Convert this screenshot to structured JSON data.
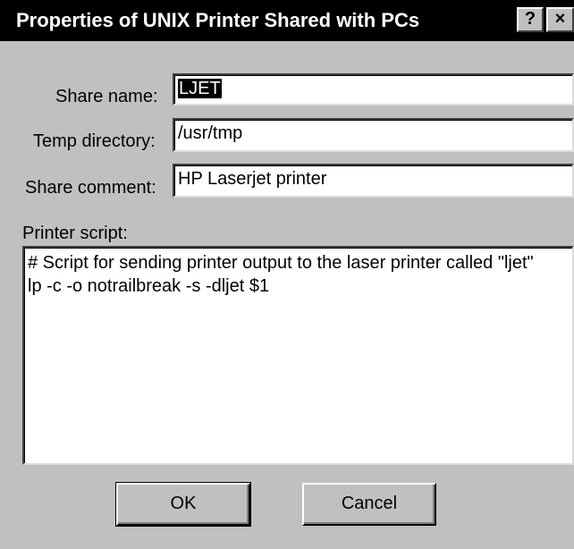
{
  "dialog": {
    "title": "Properties of UNIX Printer Shared with PCs",
    "help_button": "?",
    "close_button": "×"
  },
  "fields": {
    "share_name": {
      "label": "Share name:",
      "value": "LJET"
    },
    "temp_directory": {
      "label": "Temp directory:",
      "value": "/usr/tmp"
    },
    "share_comment": {
      "label": "Share comment:",
      "value": "HP Laserjet printer"
    }
  },
  "printer_script": {
    "label": "Printer script:",
    "value": "# Script for sending printer output to the laser printer called \"ljet\"\nlp -c -o notrailbreak -s -dljet $1"
  },
  "buttons": {
    "ok": "OK",
    "cancel": "Cancel"
  }
}
